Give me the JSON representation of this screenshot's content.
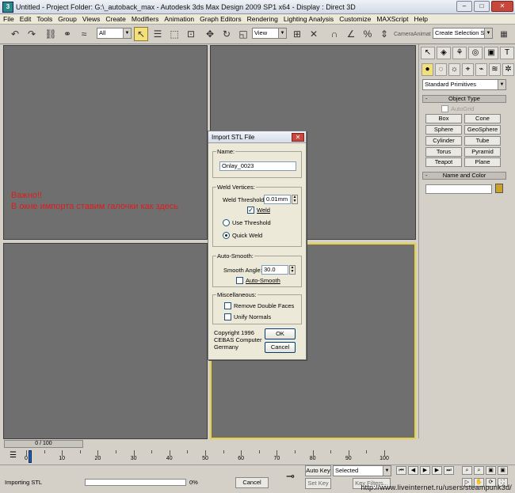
{
  "window": {
    "title": "Untitled    - Project Folder: G:\\_autoback_max    - Autodesk 3ds Max Design 2009 SP1  x64      - Display : Direct 3D",
    "minimize": "–",
    "maximize": "□",
    "close": "✕"
  },
  "menu": [
    "File",
    "Edit",
    "Tools",
    "Group",
    "Views",
    "Create",
    "Modifiers",
    "Animation",
    "Graph Editors",
    "Rendering",
    "Lighting Analysis",
    "Customize",
    "MAXScript",
    "Help"
  ],
  "toolbar": {
    "selection_filter": "All",
    "ref_coord": "View",
    "camera_label": "CameraAnimat",
    "named_selection": "Create Selection Set"
  },
  "annotation": {
    "line1": "Важно!!",
    "line2": "В окне импорта ставим галочки  как здесь"
  },
  "command_panel": {
    "category": "Standard Primitives",
    "object_type_header": "Object Type",
    "autogrid": "AutoGrid",
    "buttons": [
      "Box",
      "Cone",
      "Sphere",
      "GeoSphere",
      "Cylinder",
      "Tube",
      "Torus",
      "Pyramid",
      "Teapot",
      "Plane"
    ],
    "name_color_header": "Name and Color",
    "color": "#c9a227"
  },
  "dialog": {
    "title": "Import STL File",
    "name_group": "Name:",
    "name_value": "Onlay_0023",
    "weld_group": "Weld Vertices:",
    "weld_threshold_label": "Weld Threshold:",
    "weld_threshold_value": "0.01mm",
    "weld_label": "Weld",
    "use_threshold_label": "Use Threshold",
    "quick_weld_label": "Quick Weld",
    "smooth_group": "Auto-Smooth:",
    "smooth_angle_label": "Smooth Angle:",
    "smooth_angle_value": "30.0",
    "auto_smooth_label": "Auto-Smooth",
    "misc_group": "Miscellaneous:",
    "remove_double_label": "Remove Double Faces",
    "unify_normals_label": "Unify Normals",
    "copyright1": "Copyright 1996",
    "copyright2": "CEBAS Computer",
    "copyright3": "Germany",
    "ok": "OK",
    "cancel": "Cancel"
  },
  "timeline": {
    "slider": "0 / 100",
    "ticks": [
      "0",
      "10",
      "20",
      "30",
      "40",
      "50",
      "60",
      "70",
      "80",
      "90",
      "100"
    ]
  },
  "status": {
    "text": "Importing STL",
    "percent": "0%",
    "progress": 0,
    "cancel": "Cancel",
    "auto_key": "Auto Key",
    "key_mode": "Selected",
    "set_key": "Set Key",
    "key_filters": "Key Filters..."
  },
  "watermark": "http://www.liveinternet.ru/users/steampunk3d/"
}
